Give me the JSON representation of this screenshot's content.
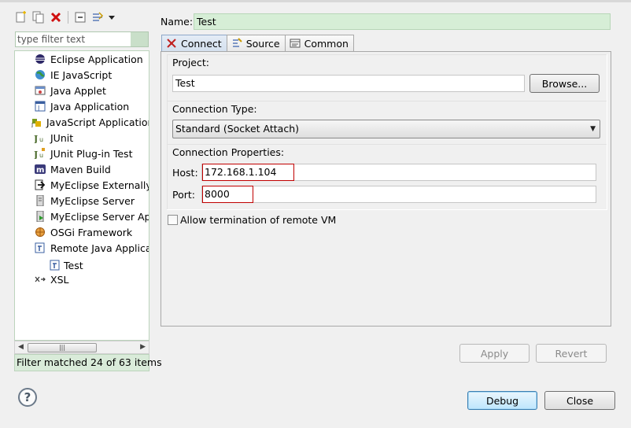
{
  "left": {
    "filter_placeholder": "type filter text",
    "tree": [
      {
        "label": "Eclipse Application",
        "icon": "eclipse-icon"
      },
      {
        "label": "IE JavaScript",
        "icon": "globe-icon"
      },
      {
        "label": "Java Applet",
        "icon": "applet-icon"
      },
      {
        "label": "Java Application",
        "icon": "java-app-icon"
      },
      {
        "label": "JavaScript Application",
        "icon": "javascript-icon"
      },
      {
        "label": "JUnit",
        "icon": "junit-icon"
      },
      {
        "label": "JUnit Plug-in Test",
        "icon": "junit-plugin-icon"
      },
      {
        "label": "Maven Build",
        "icon": "maven-icon"
      },
      {
        "label": "MyEclipse Externally L",
        "icon": "myeclipse-external-icon"
      },
      {
        "label": "MyEclipse Server",
        "icon": "server-icon"
      },
      {
        "label": "MyEclipse Server App",
        "icon": "server-app-icon"
      },
      {
        "label": "OSGi Framework",
        "icon": "osgi-icon"
      },
      {
        "label": "Remote Java Applicat",
        "icon": "remote-java-icon"
      },
      {
        "label": "Test",
        "icon": "remote-config-icon"
      },
      {
        "label": "XSL",
        "icon": "xsl-icon"
      }
    ],
    "status": "Filter matched 24 of 63 items"
  },
  "name": {
    "label": "Name:",
    "value": "Test"
  },
  "tabs": [
    {
      "label": "Connect",
      "icon": "connect-icon"
    },
    {
      "label": "Source",
      "icon": "source-icon"
    },
    {
      "label": "Common",
      "icon": "common-icon"
    }
  ],
  "connect": {
    "project_label": "Project:",
    "project_value": "Test",
    "browse": "Browse...",
    "conn_type_label": "Connection Type:",
    "conn_type_value": "Standard (Socket Attach)",
    "props_label": "Connection Properties:",
    "host_label": "Host:",
    "host_value": "172.168.1.104",
    "port_label": "Port:",
    "port_value": "8000",
    "allow_term": "Allow termination of remote VM"
  },
  "actions": {
    "apply": "Apply",
    "revert": "Revert",
    "debug": "Debug",
    "close": "Close",
    "help": "?"
  },
  "colors": {
    "filter_bg": "#d9ebd9",
    "name_bg": "#d6eed6",
    "highlight": "#c00000"
  }
}
